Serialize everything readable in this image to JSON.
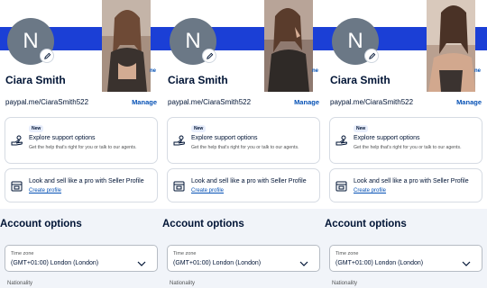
{
  "profile": {
    "initial": "N",
    "name": "Ciara Smith",
    "paypal_link": "paypal.me/CiaraSmith522",
    "manage_label": "Manage",
    "sliver_text": "ne"
  },
  "support_card": {
    "badge": "New",
    "title": "Explore support options",
    "subtitle": "Get the help that's right for you or talk to our agents."
  },
  "seller_card": {
    "title": "Look and sell like a pro with Seller Profile",
    "link": "Create profile"
  },
  "account_options": {
    "heading": "Account options",
    "timezone_label": "Time zone",
    "timezone_value": "(GMT+01:00) London (London)",
    "nationality_label": "Nationality"
  },
  "colors": {
    "brand_blue": "#1b3fd6",
    "link_blue": "#0551b5",
    "text_dark": "#001435",
    "avatar_gray": "#6b7886"
  },
  "icons": [
    "pencil-icon",
    "hand-support-icon",
    "storefront-icon",
    "chevron-down-icon"
  ]
}
